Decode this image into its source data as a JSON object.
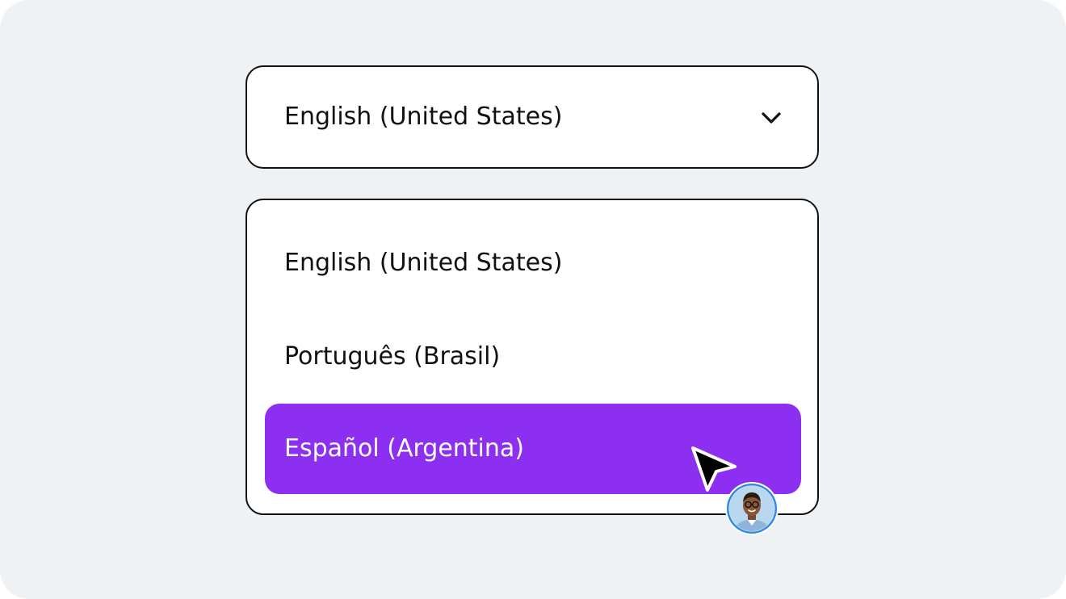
{
  "language_select": {
    "value": "English (United States)",
    "icon": "chevron-down-icon"
  },
  "dropdown": {
    "options": [
      {
        "label": "English (United States)",
        "selected": false
      },
      {
        "label": "Português (Brasil)",
        "selected": false
      },
      {
        "label": "Español (Argentina)",
        "selected": true
      }
    ]
  },
  "colors": {
    "background": "#eff2f5",
    "highlight": "#8c2ff0",
    "border": "#111111",
    "avatar_ring": "#2f8be6"
  },
  "overlay": {
    "cursor_icon": "arrow-cursor-icon",
    "avatar_icon": "user-avatar-icon"
  }
}
